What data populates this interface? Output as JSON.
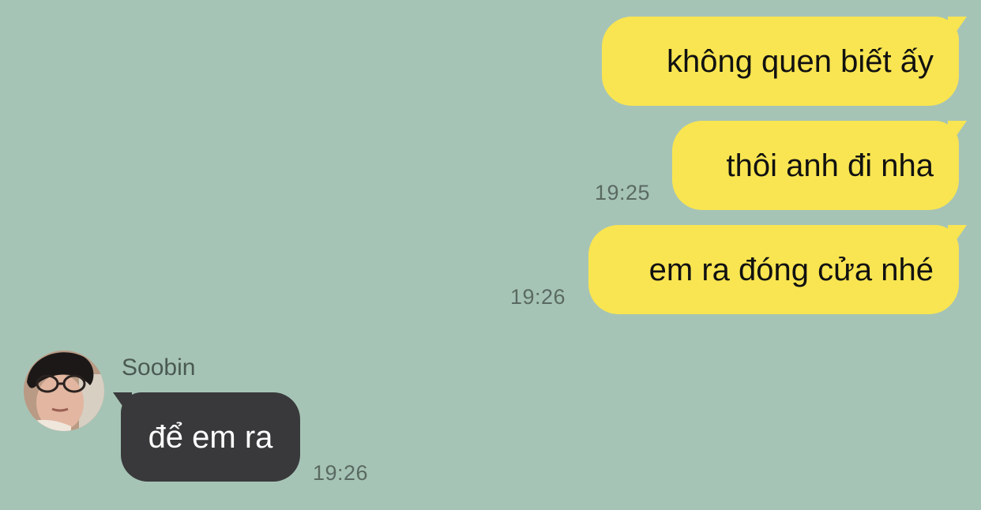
{
  "messages": [
    {
      "side": "sent",
      "text": "không quen biết ấy",
      "time": ""
    },
    {
      "side": "sent",
      "text": "thôi anh đi nha",
      "time": "19:25"
    },
    {
      "side": "sent",
      "text": "em ra đóng cửa nhé",
      "time": "19:26"
    },
    {
      "side": "received",
      "sender": "Soobin",
      "text": "để em ra",
      "time": "19:26"
    }
  ],
  "colors": {
    "background": "#a6c4b6",
    "sent_bubble": "#f9e551",
    "received_bubble": "#39393b",
    "timestamp": "#5a6a62"
  },
  "icons": {
    "avatar": "profile-photo-avatar"
  }
}
